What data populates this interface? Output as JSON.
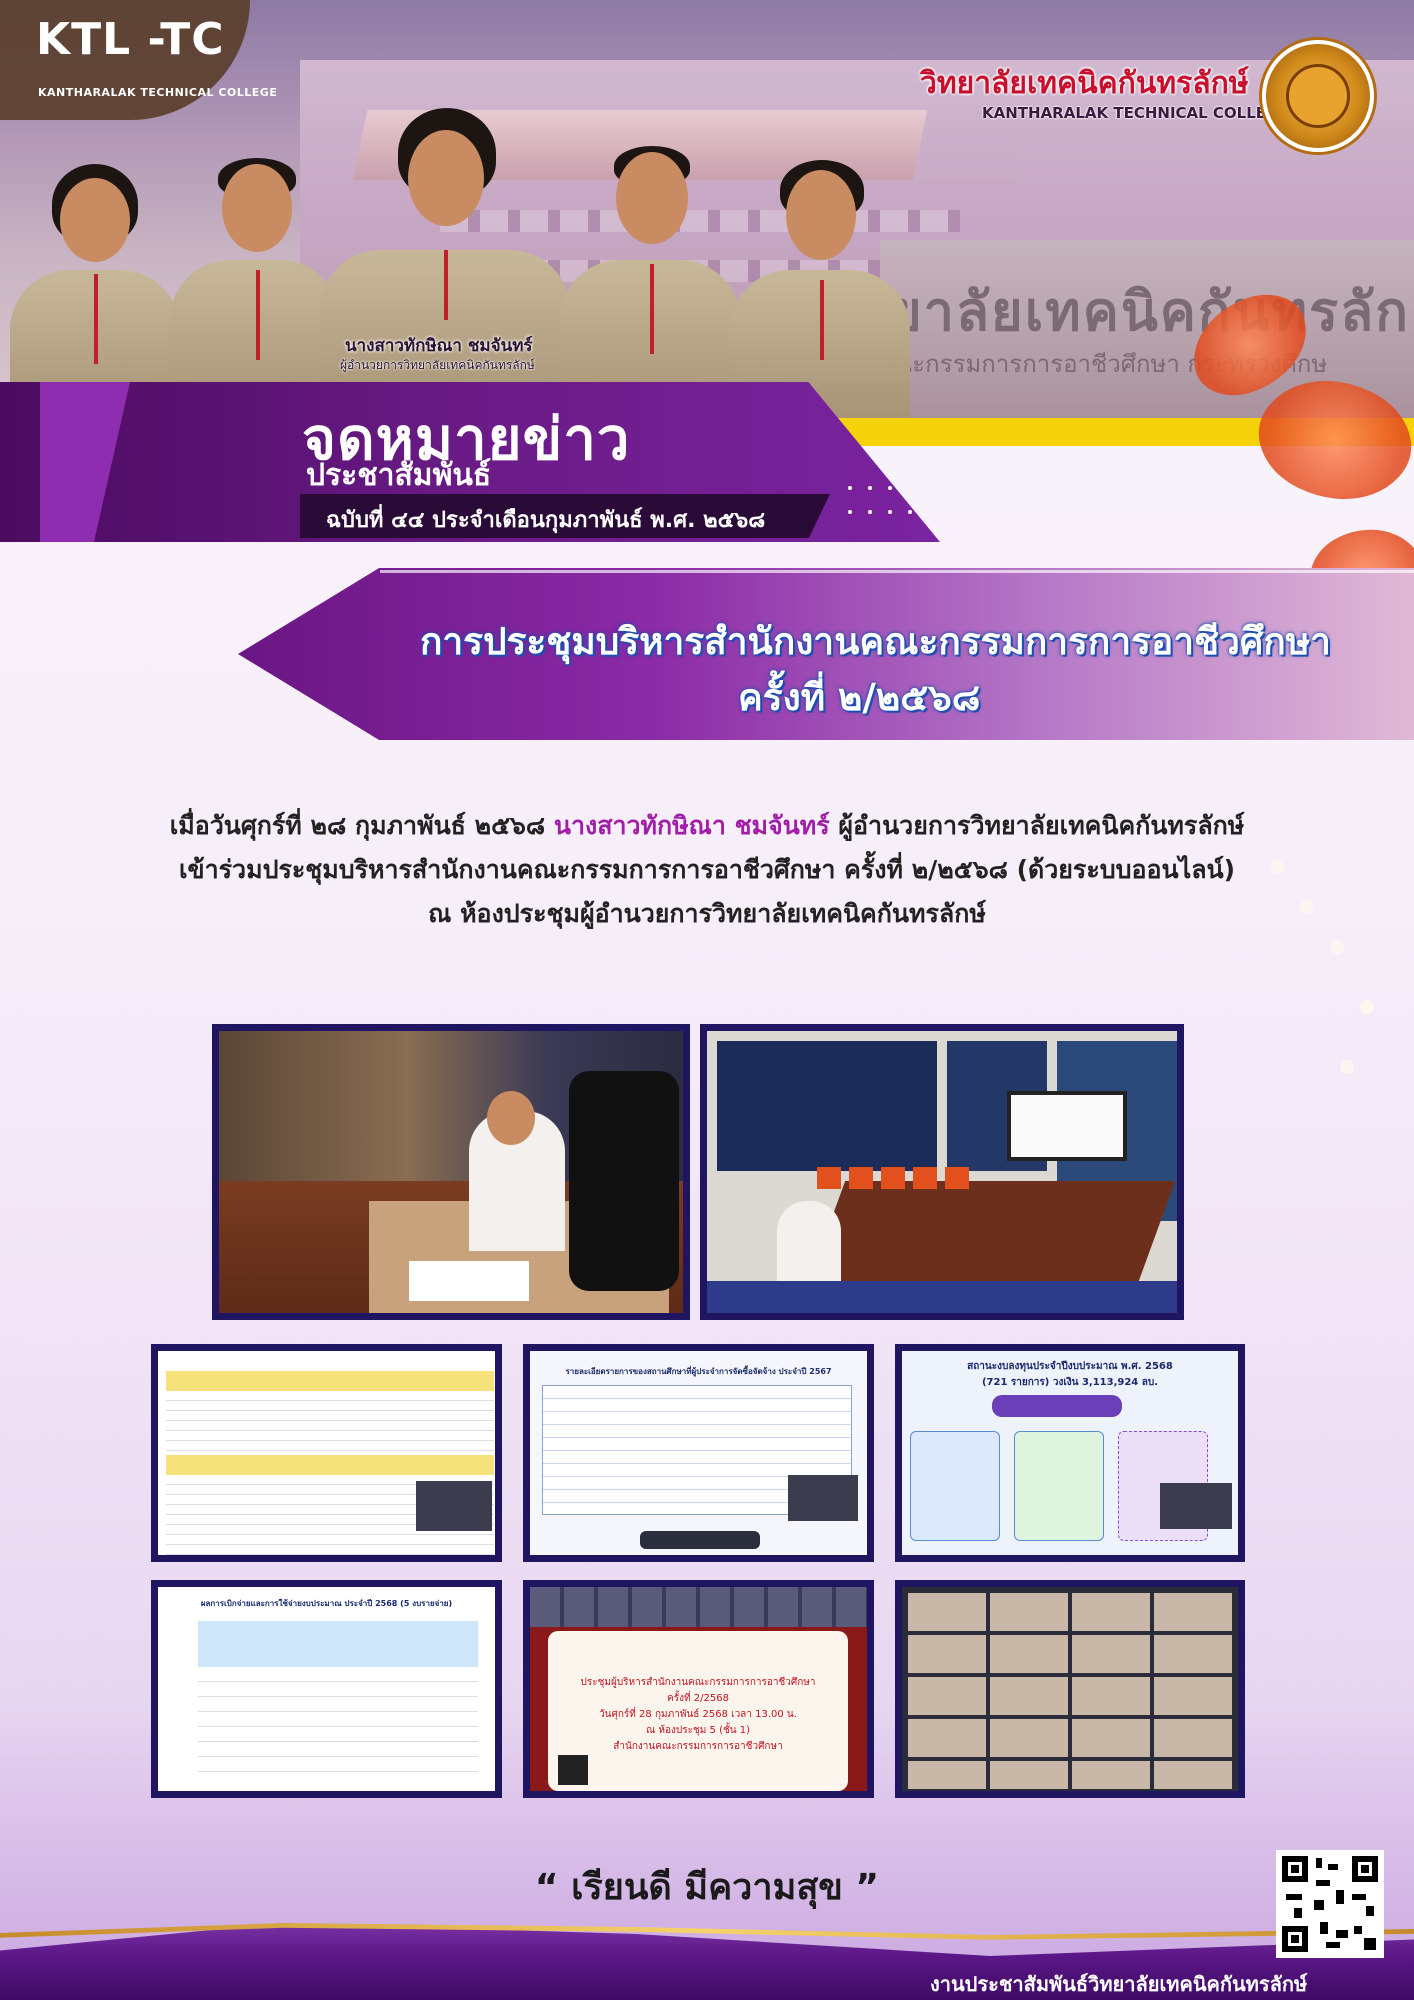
{
  "header": {
    "logo_text": "KTL -TC",
    "logo_sub": "KANTHARALAK TECHNICAL COLLEGE",
    "college_name_th": "วิทยาลัยเทคนิคกันทรลักษ์",
    "college_name_en": "KANTHARALAK TECHNICAL COLLEGE",
    "building_sign": "ยาลัยเทคนิคกันทรลัก",
    "building_sign_sub": "ณะกรรมการการอาชีวศึกษา  กระทรวงศึกษ",
    "director_name": "นางสาวทักษิณา ชมจันทร์",
    "director_title": "ผู้อำนวยการวิทยาลัยเทคนิคกันทรลักษ์"
  },
  "newsletter": {
    "title": "จดหมายข่าว",
    "subtitle": "ประชาสัมพันธ์",
    "issue": "ฉบับที่ ๔๔ ประจำเดือนกุมภาพันธ์ พ.ศ. ๒๕๖๘"
  },
  "headline": {
    "line1": "การประชุมบริหารสำนักงานคณะกรรมการการอาชีวศึกษา",
    "line2": "ครั้งที่ ๒/๒๕๖๘"
  },
  "body": {
    "line1_pre": "เมื่อวันศุกร์ที่ ๒๘ กุมภาพันธ์ ๒๕๖๘ ",
    "line1_name": "นางสาวทักษิณา ชมจันทร์",
    "line1_post": " ผู้อำนวยการวิทยาลัยเทคนิคกันทรลักษ์",
    "line2": "เข้าร่วมประชุมบริหารสำนักงานคณะกรรมการการอาชีวศึกษา ครั้งที่ ๒/๒๕๖๘ (ด้วยระบบออนไลน์)",
    "line3": "ณ ห้องประชุมผู้อำนวยการวิทยาลัยเทคนิคกันทรลักษ์"
  },
  "photos": {
    "slide_table_title": "รายละเอียดรายการของสถานศึกษาที่ผู้ประจำการจัดซื้อจัดจ้าง ประจำปี 2567",
    "slide_status_title": "สถานะงบลงทุนประจำปีงบประมาณ พ.ศ. 2568",
    "slide_status_sub": "(721 รายการ) วงเงิน 3,113,924 ลบ.",
    "slide_budget_title": "ผลการเบิกจ่ายและการใช้จ่ายงบประมาณ ประจำปี 2568 (5 งบรายจ่าย)",
    "slide_meeting_l1": "ประชุมผู้บริหารสำนักงานคณะกรรมการการอาชีวศึกษา",
    "slide_meeting_l2": "ครั้งที่ 2/2568",
    "slide_meeting_l3": "วันศุกร์ที่ 28 กุมภาพันธ์ 2568 เวลา 13.00 น.",
    "slide_meeting_l4": "ณ ห้องประชุม 5 (ชั้น 1)",
    "slide_meeting_l5": "สำนักงานคณะกรรมการการอาชีวศึกษา"
  },
  "footer": {
    "slogan": "“ เรียนดี มีความสุข ”",
    "credit": "งานประชาสัมพันธ์วิทยาลัยเทคนิคกันทรลักษ์"
  },
  "colors": {
    "primary_purple": "#6a1b86",
    "highlight_magenta": "#a01ea8",
    "headline_blue_outline": "#1e4fb0",
    "accent_yellow": "#f5d20a",
    "college_red": "#c8102e",
    "photo_frame": "#1f1560"
  }
}
